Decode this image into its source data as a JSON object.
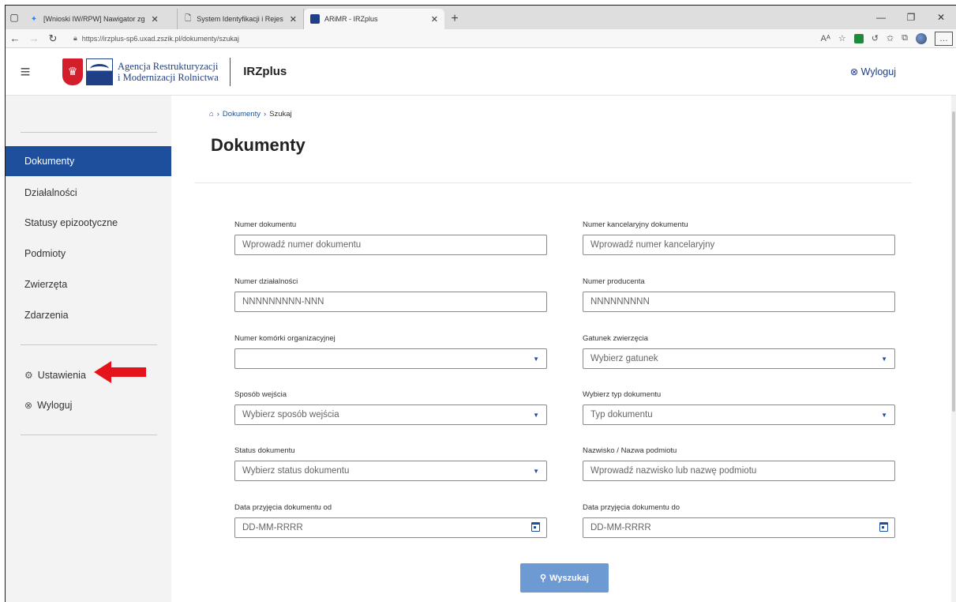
{
  "browser": {
    "tabs": [
      {
        "title": "[Wnioski IW/RPW] Nawigator zg",
        "icon": "jira-icon"
      },
      {
        "title": "System Identyfikacji i Rejestracji",
        "icon": "page-icon"
      },
      {
        "title": "ARiMR - IRZplus",
        "icon": "arimr-favicon"
      }
    ],
    "url": "https://irzplus-sp6.uxad.zszik.pl/dokumenty/szukaj"
  },
  "header": {
    "org_line1": "Agencja Restrukturyzacji",
    "org_line2": "i Modernizacji Rolnictwa",
    "logo_small_text": "ARiMR",
    "app_name": "IRZplus",
    "logout": "Wyloguj"
  },
  "sidebar": {
    "items": [
      "Dokumenty",
      "Działalności",
      "Statusy epizootyczne",
      "Podmioty",
      "Zwierzęta",
      "Zdarzenia"
    ],
    "settings": "Ustawienia",
    "logout": "Wyloguj"
  },
  "breadcrumb": {
    "section": "Dokumenty",
    "current": "Szukaj"
  },
  "page_title": "Dokumenty",
  "form": {
    "doc_number": {
      "label": "Numer dokumentu",
      "placeholder": "Wprowadź numer dokumentu"
    },
    "chancery_number": {
      "label": "Numer kancelaryjny dokumentu",
      "placeholder": "Wprowadź numer kancelaryjny"
    },
    "activity_number": {
      "label": "Numer działalności",
      "placeholder": "NNNNNNNNN-NNN"
    },
    "producer_number": {
      "label": "Numer producenta",
      "placeholder": "NNNNNNNNN"
    },
    "org_unit": {
      "label": "Numer komórki organizacyjnej",
      "placeholder": ""
    },
    "species": {
      "label": "Gatunek zwierzęcia",
      "placeholder": "Wybierz gatunek"
    },
    "entry_method": {
      "label": "Sposób wejścia",
      "placeholder": "Wybierz sposób wejścia"
    },
    "doc_type": {
      "label": "Wybierz typ dokumentu",
      "placeholder": "Typ dokumentu"
    },
    "doc_status": {
      "label": "Status dokumentu",
      "placeholder": "Wybierz status dokumentu"
    },
    "entity_name": {
      "label": "Nazwisko / Nazwa podmiotu",
      "placeholder": "Wprowadź nazwisko lub nazwę podmiotu"
    },
    "date_from": {
      "label": "Data przyjęcia dokumentu od",
      "placeholder": "DD-MM-RRRR"
    },
    "date_to": {
      "label": "Data przyjęcia dokumentu do",
      "placeholder": "DD-MM-RRRR"
    },
    "search_button": "Wyszukaj"
  },
  "colors": {
    "primary": "#1d4f9c",
    "button": "#6e9ad4",
    "annotation_arrow": "#e5141a"
  }
}
